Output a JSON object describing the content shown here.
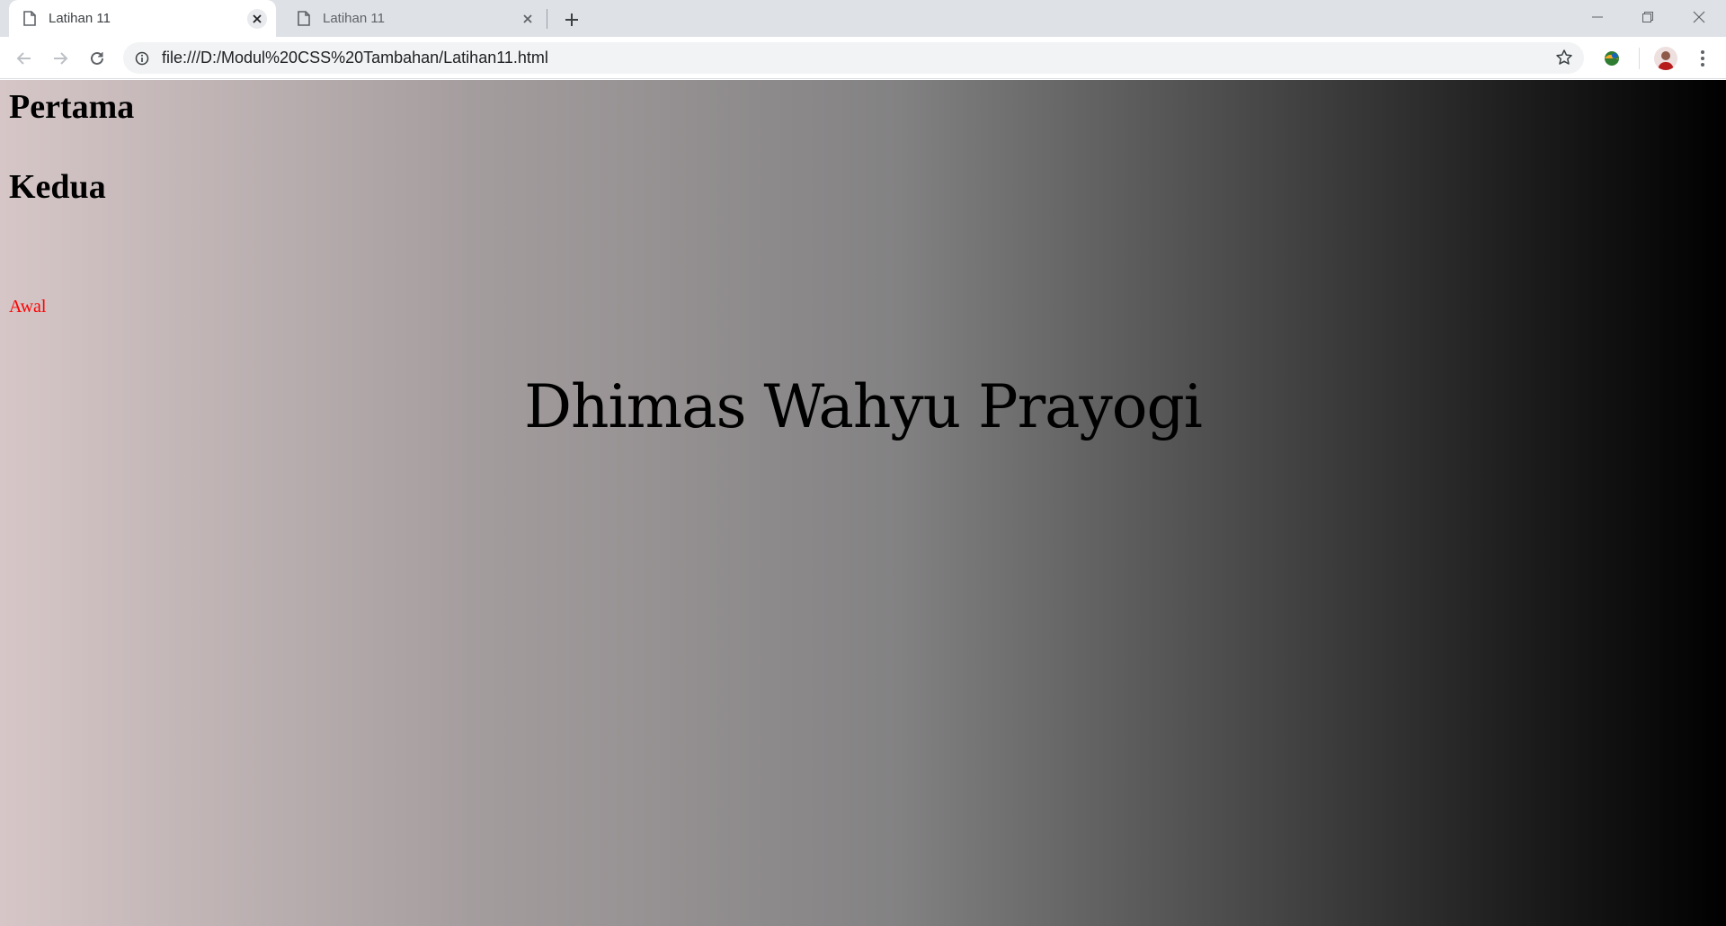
{
  "browser": {
    "tabs": [
      {
        "title": "Latihan 11",
        "active": true
      },
      {
        "title": "Latihan 11",
        "active": false
      }
    ],
    "address_url": "file:///D:/Modul%20CSS%20Tambahan/Latihan11.html",
    "icons": {
      "back": "arrow-left-icon",
      "forward": "arrow-right-icon",
      "reload": "reload-icon",
      "info": "info-icon",
      "bookmark": "star-icon",
      "extension": "extension-icon",
      "profile": "avatar",
      "menu": "more-vert-icon",
      "new_tab": "plus-icon",
      "minimize": "minimize-icon",
      "restore": "restore-icon",
      "close": "close-icon"
    }
  },
  "page": {
    "heading_1": "Pertama",
    "heading_2": "Kedua",
    "link_text": "Awal",
    "name": "Dhimas Wahyu Prayogi",
    "colors": {
      "link": "#ff0000",
      "gradient_start": "#d6c6c7",
      "gradient_end": "#000000"
    }
  }
}
